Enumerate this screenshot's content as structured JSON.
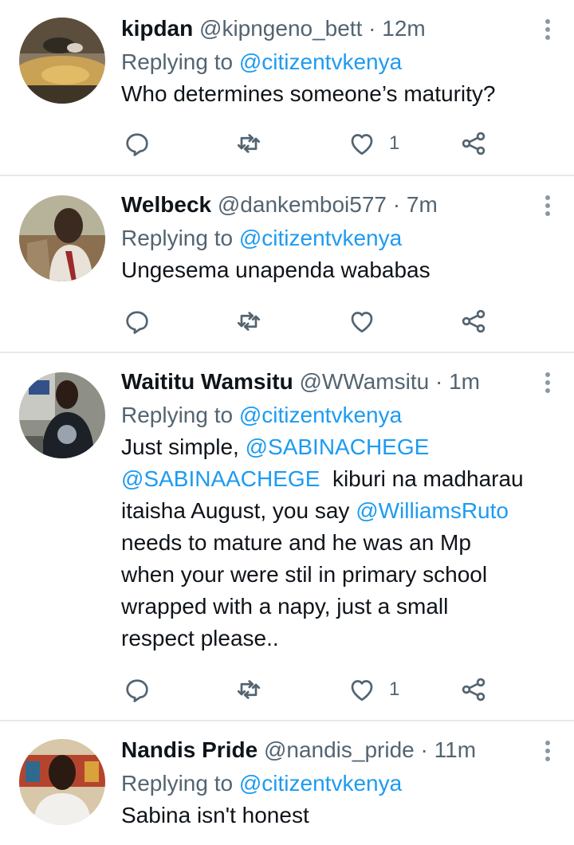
{
  "tweets": [
    {
      "name": "kipdan",
      "handle": "@kipngeno_bett",
      "sep": "·",
      "time": "12m",
      "replying_label": "Replying to",
      "replying_to": "@citizentvkenya",
      "text_parts": [
        "Who determines someone’s maturity?"
      ],
      "like_count": "1",
      "avatar": "avatar-mud-puddle"
    },
    {
      "name": "Welbeck",
      "handle": "@dankemboi577",
      "sep": "·",
      "time": "7m",
      "replying_label": "Replying to",
      "replying_to": "@citizentvkenya",
      "text_parts": [
        "Ungesema unapenda wababas"
      ],
      "like_count": "",
      "avatar": "avatar-man-outdoors"
    },
    {
      "name": "Waititu Wamsitu",
      "handle": "@WWamsitu",
      "sep": "·",
      "time": "1m",
      "replying_label": "Replying to",
      "replying_to": "@citizentvkenya",
      "text_intro": "Just simple,",
      "mention1": "@SABINACHEGE",
      "mention2": "@SABINAACHEGE",
      "text_mid": "kiburi na madharau itaisha August, you say",
      "mention3": "@WilliamsRuto",
      "text_end": "needs to mature and he was an Mp when your were stil in primary school wrapped with a napy, just a small respect please..",
      "like_count": "1",
      "avatar": "avatar-man-tshirt"
    },
    {
      "name": "Nandis Pride",
      "handle": "@nandis_pride",
      "sep": "·",
      "time": "11m",
      "replying_label": "Replying to",
      "replying_to": "@citizentvkenya",
      "text_parts": [
        "Sabina isn't honest"
      ],
      "avatar": "avatar-man-portrait"
    }
  ],
  "icons": {
    "reply": "reply-icon",
    "retweet": "retweet-icon",
    "like": "heart-icon",
    "share": "share-icon",
    "more": "more-vertical-icon"
  },
  "colors": {
    "link": "#1d9bf0",
    "secondary_text": "#536471",
    "icon": "#536471",
    "divider": "#e6e9ec"
  }
}
